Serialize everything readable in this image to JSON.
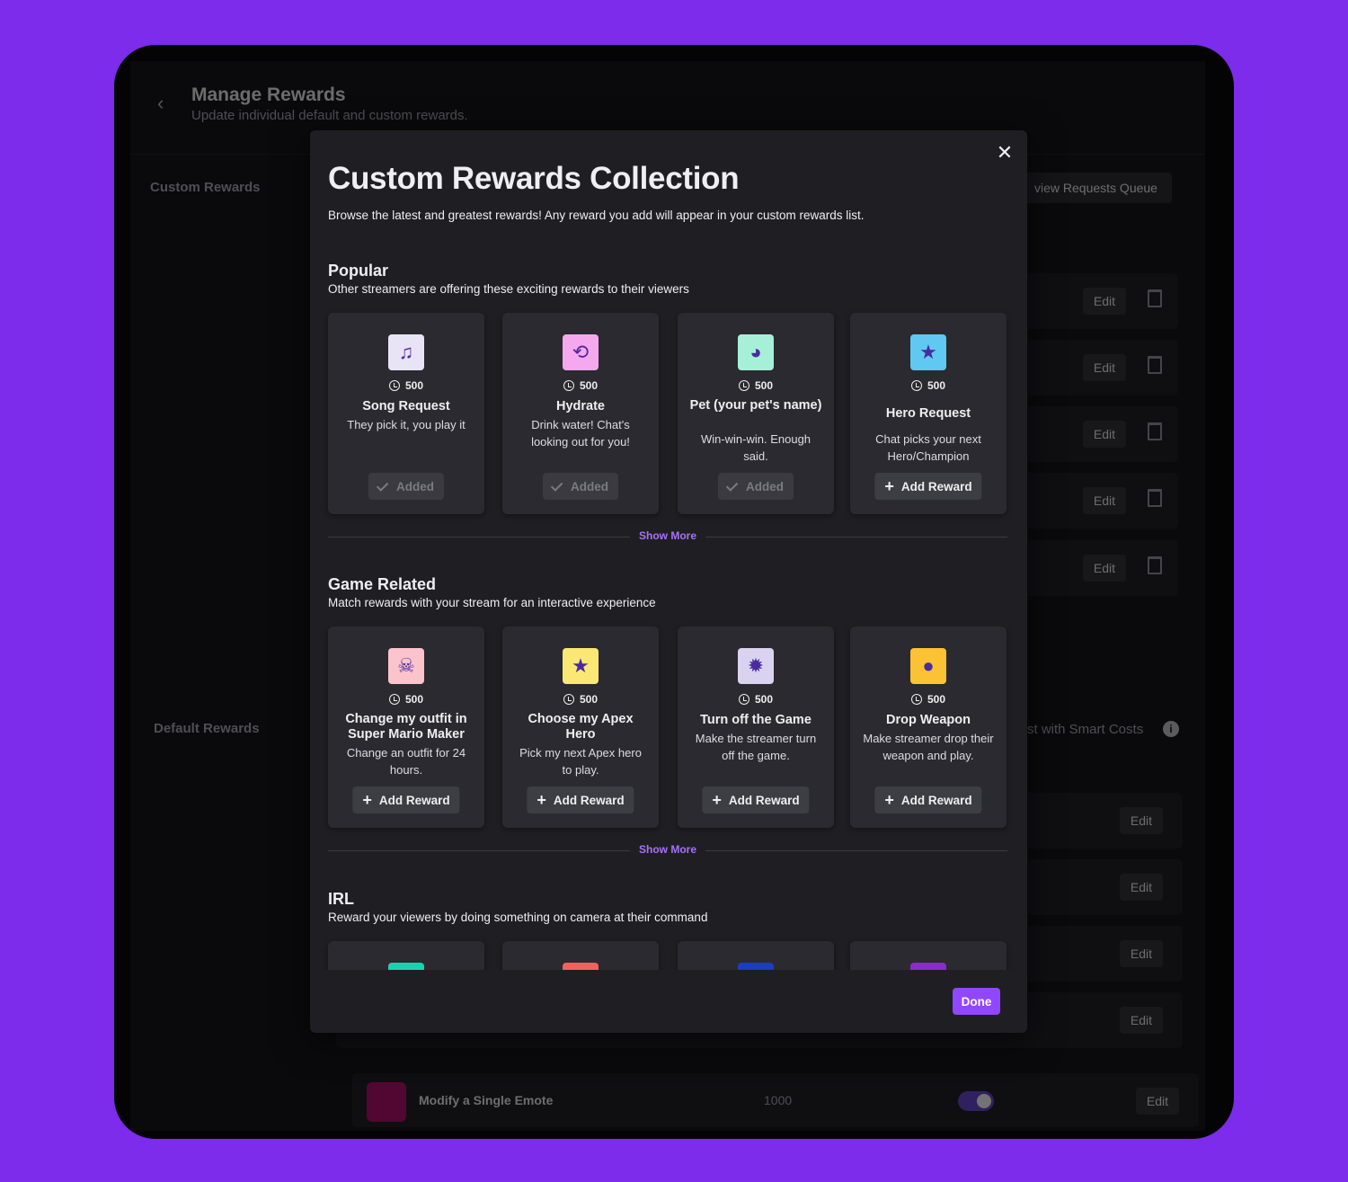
{
  "background": {
    "title": "Manage Rewards",
    "subtitle": "Update individual default and custom rewards.",
    "custom_label": "Custom Rewards",
    "default_label": "Default Rewards",
    "queue_button": "view Requests Queue",
    "smart_costs": "st with Smart Costs",
    "info_glyph": "i",
    "edit_label": "Edit",
    "emote_row": {
      "label": "Modify a Single Emote",
      "cost": "1000"
    }
  },
  "modal": {
    "title": "Custom Rewards Collection",
    "subtitle": "Browse the latest and greatest rewards! Any reward you add will appear in your custom rewards list.",
    "close_glyph": "✕",
    "show_more": "Show More",
    "done_label": "Done",
    "added_label": "Added",
    "add_label": "Add Reward",
    "sections": [
      {
        "title": "Popular",
        "description": "Other streamers are offering these exciting rewards to their viewers",
        "cards": [
          {
            "cost": "500",
            "name": "Song Request",
            "description": "They pick it, you play it",
            "status": "added",
            "icon": "music-note-icon",
            "icon_bg": "#e8e4f6",
            "glyph": "♫"
          },
          {
            "cost": "500",
            "name": "Hydrate",
            "description": "Drink water! Chat's looking out for you!",
            "status": "added",
            "icon": "refresh-icon",
            "icon_bg": "#f6a8ee",
            "glyph": "⟲"
          },
          {
            "cost": "500",
            "name": "Pet (your pet's name)",
            "description": "Win-win-win. Enough said.",
            "status": "added",
            "icon": "bird-icon",
            "icon_bg": "#a6f0d8",
            "glyph": "◕"
          },
          {
            "cost": "500",
            "name": "Hero Request",
            "description": "Chat picks your next Hero/Champion",
            "status": "add",
            "icon": "star-icon",
            "icon_bg": "#5fc9f2",
            "glyph": "★"
          }
        ]
      },
      {
        "title": "Game Related",
        "description": "Match rewards with your stream for an interactive experience",
        "cards": [
          {
            "cost": "500",
            "name": "Change my outfit in Super Mario Maker",
            "description": "Change an outfit for 24 hours.",
            "status": "add",
            "icon": "pirate-hat-icon",
            "icon_bg": "#fbc4cc",
            "glyph": "☠"
          },
          {
            "cost": "500",
            "name": "Choose my Apex Hero",
            "description": "Pick my next Apex hero to play.",
            "status": "add",
            "icon": "star-icon",
            "icon_bg": "#fbe774",
            "glyph": "★"
          },
          {
            "cost": "500",
            "name": "Turn off the Game",
            "description": "Make the streamer turn off the game.",
            "status": "add",
            "icon": "burst-icon",
            "icon_bg": "#d9d3f0",
            "glyph": "✹"
          },
          {
            "cost": "500",
            "name": "Drop Weapon",
            "description": "Make streamer drop their weapon and play.",
            "status": "add",
            "icon": "bomb-icon",
            "icon_bg": "#fbc234",
            "glyph": "●"
          }
        ]
      },
      {
        "title": "IRL",
        "description": "Reward your viewers by doing something on camera at their command",
        "cards": [
          {
            "icon": "music-note-icon",
            "icon_bg": "#19d3b0",
            "glyph": "♫"
          },
          {
            "icon": "refresh-icon",
            "icon_bg": "#f4605e",
            "glyph": "⟲"
          },
          {
            "icon": "bird-icon",
            "icon_bg": "#1c3cc2",
            "glyph": "◕"
          },
          {
            "icon": "star-icon",
            "icon_bg": "#8a2bd0",
            "glyph": "★"
          }
        ]
      }
    ]
  }
}
